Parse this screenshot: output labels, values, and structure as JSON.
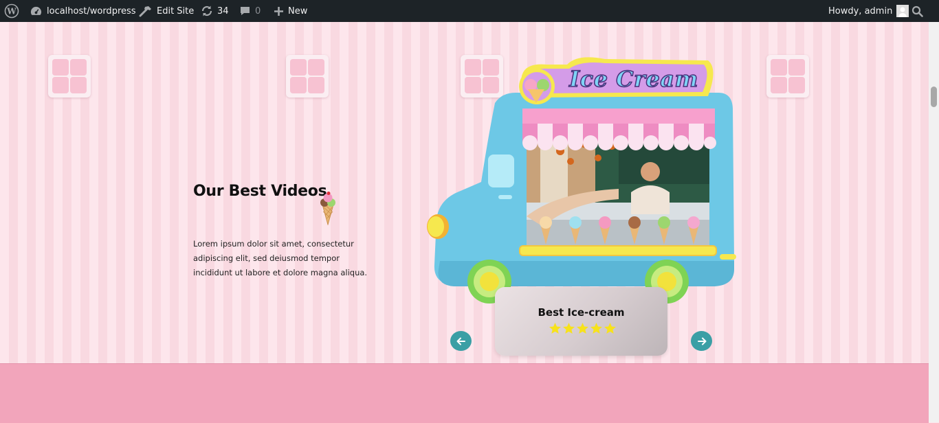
{
  "adminbar": {
    "site_name": "localhost/wordpress",
    "edit_site": "Edit Site",
    "updates_count": "34",
    "comments_count": "0",
    "new_label": "New",
    "greeting": "Howdy, admin"
  },
  "hero": {
    "heading": "Our Best Videos",
    "body": "Lorem ipsum dolor sit amet, consectetur adipiscing elit, sed deiusmod tempor incididunt ut labore et dolore magna aliqua.",
    "truck_sign": "Ice Cream"
  },
  "card": {
    "title": "Best Ice-cream",
    "rating": 5,
    "rating_max": 5
  },
  "colors": {
    "adminbar_bg": "#1d2327",
    "stripe_light": "#fde6ec",
    "stripe_dark": "#f9d9e1",
    "footer_band": "#f2a5bb",
    "truck_blue": "#6dc8e6",
    "awning_pink": "#ee8cc2",
    "star_yellow": "#f7e21b",
    "arrow_teal": "#3a9fa5"
  },
  "icons": {
    "wp_logo": "wordpress-logo-icon",
    "dashboard": "dashboard-icon",
    "edit": "hammer-icon",
    "updates": "refresh-icon",
    "comments": "comment-icon",
    "new": "plus-icon",
    "search": "search-icon",
    "prev": "arrow-left-icon",
    "next": "arrow-right-icon"
  }
}
